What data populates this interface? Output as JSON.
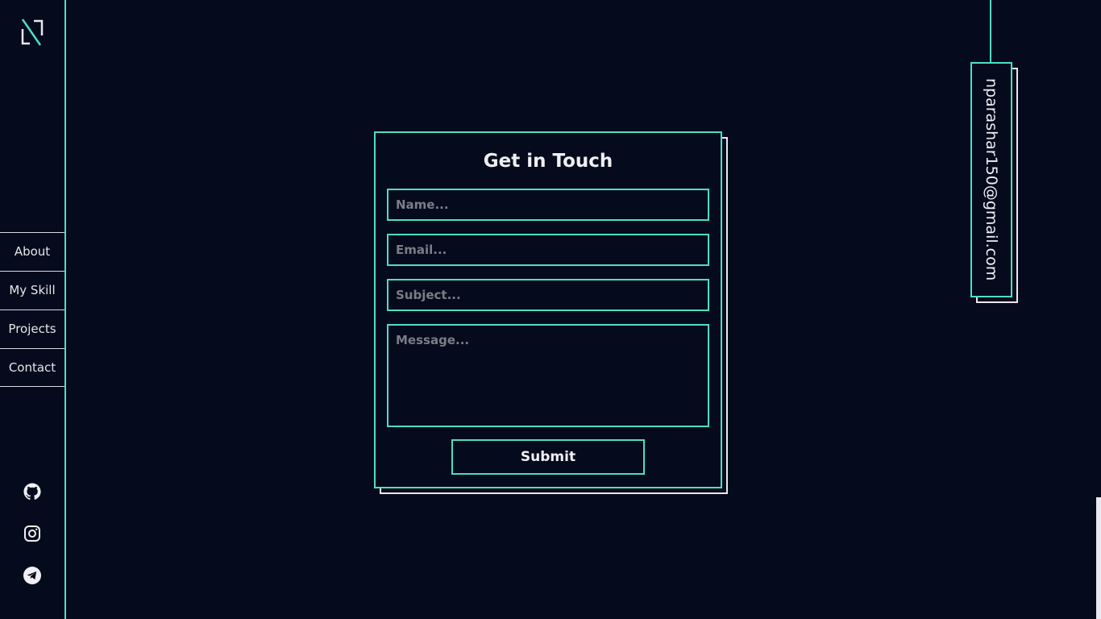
{
  "brand": {
    "logo_icon": "nl-monogram-logo-icon",
    "accent_color": "#4cdfc4",
    "background_color": "#050b1c"
  },
  "nav": {
    "items": [
      {
        "label": "About"
      },
      {
        "label": "My Skill"
      },
      {
        "label": "Projects"
      },
      {
        "label": "Contact"
      }
    ]
  },
  "socials": [
    {
      "icon": "github-icon"
    },
    {
      "icon": "instagram-icon"
    },
    {
      "icon": "telegram-icon"
    }
  ],
  "contact_form": {
    "title": "Get in Touch",
    "name_placeholder": "Name...",
    "email_placeholder": "Email...",
    "subject_placeholder": "Subject...",
    "message_placeholder": "Message...",
    "submit_label": "Submit"
  },
  "email_tag": {
    "text": "nparashar150@gmail.com"
  }
}
